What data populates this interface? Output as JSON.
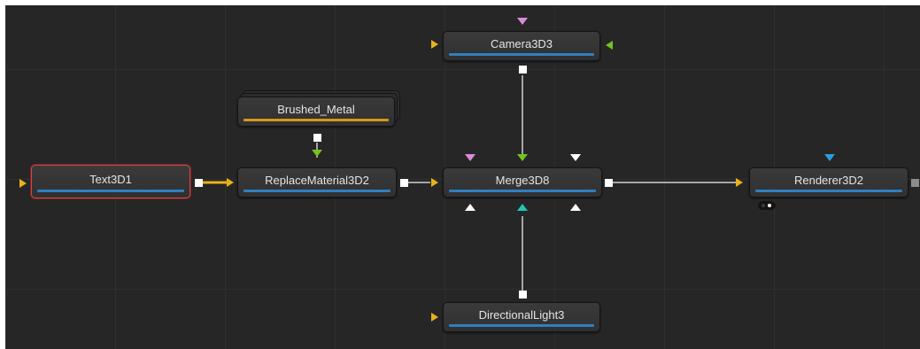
{
  "colors": {
    "canvas_bg": "#262626",
    "grid_line": "#2f2f2f",
    "node_bar_blue": "#2f7fbf",
    "node_bar_orange": "#d7981e",
    "selected_border": "#c94a4a",
    "input_yellow": "#e8b21b",
    "input_green": "#74c41c",
    "input_pink": "#d98ad9",
    "input_cyan": "#1fc7b5",
    "input_blue": "#2a9be0",
    "output_white": "#ffffff",
    "output_grey": "#8c8c8c"
  },
  "nodes": {
    "text3d": {
      "label": "Text3D1",
      "selected": true
    },
    "brushed_metal": {
      "label": "Brushed_Metal"
    },
    "replace_material": {
      "label": "ReplaceMaterial3D2"
    },
    "camera": {
      "label": "Camera3D3"
    },
    "merge": {
      "label": "Merge3D8"
    },
    "directional_light": {
      "label": "DirectionalLight3"
    },
    "renderer": {
      "label": "Renderer3D2"
    }
  },
  "icons": {
    "input_arrow": "triangle-right",
    "mask_input": "triangle-down",
    "output_port": "square",
    "view_indicator": "dot-pair"
  }
}
